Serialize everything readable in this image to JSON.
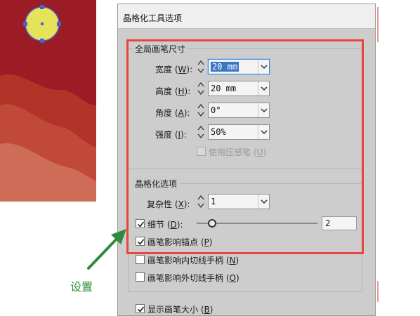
{
  "dialog": {
    "title": "晶格化工具选项"
  },
  "brush_size_group": {
    "label": "全局画笔尺寸",
    "width": {
      "label": "宽度",
      "key": "W",
      "value": "20 mm"
    },
    "height": {
      "label": "高度",
      "key": "H",
      "value": "20 mm"
    },
    "angle": {
      "label": "角度",
      "key": "A",
      "value": "0°"
    },
    "intensity": {
      "label": "强度",
      "key": "I",
      "value": "50%"
    },
    "pressure_pen": {
      "label": "使用压感笔",
      "key": "U",
      "checked": false,
      "disabled": true
    }
  },
  "crystallize_group": {
    "label": "晶格化选项",
    "complexity": {
      "label": "复杂性",
      "key": "X",
      "value": "1"
    },
    "detail": {
      "label": "细节",
      "key": "D",
      "checked": true,
      "value": "2",
      "slider_level": 0.12
    },
    "brush_anchor": {
      "label": "画笔影响锚点",
      "key": "P",
      "checked": true
    },
    "brush_in_tangent": {
      "label": "画笔影响内切线手柄",
      "key": "N",
      "checked": false
    },
    "brush_out_tangent": {
      "label": "画笔影响外切线手柄",
      "key": "O",
      "checked": false
    }
  },
  "show_brush_size": {
    "label": "显示画笔大小",
    "key": "B",
    "checked": true
  },
  "annotation": {
    "text": "设置"
  },
  "colors": {
    "highlight_box": "#e8453c",
    "annotation_green": "#2f8a3a",
    "artboard_red": "#9c1c26",
    "sun_yellow": "#e6e35a"
  },
  "icons": [
    "spinner-icon",
    "dropdown-arrow-icon",
    "checkmark-icon",
    "arrow-icon"
  ]
}
